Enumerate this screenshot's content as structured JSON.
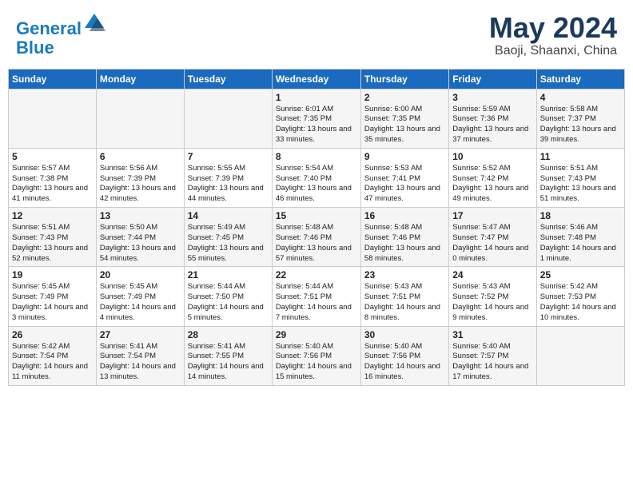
{
  "header": {
    "logo_line1": "General",
    "logo_line2": "Blue",
    "month_title": "May 2024",
    "location": "Baoji, Shaanxi, China"
  },
  "days_of_week": [
    "Sunday",
    "Monday",
    "Tuesday",
    "Wednesday",
    "Thursday",
    "Friday",
    "Saturday"
  ],
  "weeks": [
    [
      {
        "day": "",
        "content": ""
      },
      {
        "day": "",
        "content": ""
      },
      {
        "day": "",
        "content": ""
      },
      {
        "day": "1",
        "content": "Sunrise: 6:01 AM\nSunset: 7:35 PM\nDaylight: 13 hours\nand 33 minutes."
      },
      {
        "day": "2",
        "content": "Sunrise: 6:00 AM\nSunset: 7:35 PM\nDaylight: 13 hours\nand 35 minutes."
      },
      {
        "day": "3",
        "content": "Sunrise: 5:59 AM\nSunset: 7:36 PM\nDaylight: 13 hours\nand 37 minutes."
      },
      {
        "day": "4",
        "content": "Sunrise: 5:58 AM\nSunset: 7:37 PM\nDaylight: 13 hours\nand 39 minutes."
      }
    ],
    [
      {
        "day": "5",
        "content": "Sunrise: 5:57 AM\nSunset: 7:38 PM\nDaylight: 13 hours\nand 41 minutes."
      },
      {
        "day": "6",
        "content": "Sunrise: 5:56 AM\nSunset: 7:39 PM\nDaylight: 13 hours\nand 42 minutes."
      },
      {
        "day": "7",
        "content": "Sunrise: 5:55 AM\nSunset: 7:39 PM\nDaylight: 13 hours\nand 44 minutes."
      },
      {
        "day": "8",
        "content": "Sunrise: 5:54 AM\nSunset: 7:40 PM\nDaylight: 13 hours\nand 46 minutes."
      },
      {
        "day": "9",
        "content": "Sunrise: 5:53 AM\nSunset: 7:41 PM\nDaylight: 13 hours\nand 47 minutes."
      },
      {
        "day": "10",
        "content": "Sunrise: 5:52 AM\nSunset: 7:42 PM\nDaylight: 13 hours\nand 49 minutes."
      },
      {
        "day": "11",
        "content": "Sunrise: 5:51 AM\nSunset: 7:43 PM\nDaylight: 13 hours\nand 51 minutes."
      }
    ],
    [
      {
        "day": "12",
        "content": "Sunrise: 5:51 AM\nSunset: 7:43 PM\nDaylight: 13 hours\nand 52 minutes."
      },
      {
        "day": "13",
        "content": "Sunrise: 5:50 AM\nSunset: 7:44 PM\nDaylight: 13 hours\nand 54 minutes."
      },
      {
        "day": "14",
        "content": "Sunrise: 5:49 AM\nSunset: 7:45 PM\nDaylight: 13 hours\nand 55 minutes."
      },
      {
        "day": "15",
        "content": "Sunrise: 5:48 AM\nSunset: 7:46 PM\nDaylight: 13 hours\nand 57 minutes."
      },
      {
        "day": "16",
        "content": "Sunrise: 5:48 AM\nSunset: 7:46 PM\nDaylight: 13 hours\nand 58 minutes."
      },
      {
        "day": "17",
        "content": "Sunrise: 5:47 AM\nSunset: 7:47 PM\nDaylight: 14 hours\nand 0 minutes."
      },
      {
        "day": "18",
        "content": "Sunrise: 5:46 AM\nSunset: 7:48 PM\nDaylight: 14 hours\nand 1 minute."
      }
    ],
    [
      {
        "day": "19",
        "content": "Sunrise: 5:45 AM\nSunset: 7:49 PM\nDaylight: 14 hours\nand 3 minutes."
      },
      {
        "day": "20",
        "content": "Sunrise: 5:45 AM\nSunset: 7:49 PM\nDaylight: 14 hours\nand 4 minutes."
      },
      {
        "day": "21",
        "content": "Sunrise: 5:44 AM\nSunset: 7:50 PM\nDaylight: 14 hours\nand 5 minutes."
      },
      {
        "day": "22",
        "content": "Sunrise: 5:44 AM\nSunset: 7:51 PM\nDaylight: 14 hours\nand 7 minutes."
      },
      {
        "day": "23",
        "content": "Sunrise: 5:43 AM\nSunset: 7:51 PM\nDaylight: 14 hours\nand 8 minutes."
      },
      {
        "day": "24",
        "content": "Sunrise: 5:43 AM\nSunset: 7:52 PM\nDaylight: 14 hours\nand 9 minutes."
      },
      {
        "day": "25",
        "content": "Sunrise: 5:42 AM\nSunset: 7:53 PM\nDaylight: 14 hours\nand 10 minutes."
      }
    ],
    [
      {
        "day": "26",
        "content": "Sunrise: 5:42 AM\nSunset: 7:54 PM\nDaylight: 14 hours\nand 11 minutes."
      },
      {
        "day": "27",
        "content": "Sunrise: 5:41 AM\nSunset: 7:54 PM\nDaylight: 14 hours\nand 13 minutes."
      },
      {
        "day": "28",
        "content": "Sunrise: 5:41 AM\nSunset: 7:55 PM\nDaylight: 14 hours\nand 14 minutes."
      },
      {
        "day": "29",
        "content": "Sunrise: 5:40 AM\nSunset: 7:56 PM\nDaylight: 14 hours\nand 15 minutes."
      },
      {
        "day": "30",
        "content": "Sunrise: 5:40 AM\nSunset: 7:56 PM\nDaylight: 14 hours\nand 16 minutes."
      },
      {
        "day": "31",
        "content": "Sunrise: 5:40 AM\nSunset: 7:57 PM\nDaylight: 14 hours\nand 17 minutes."
      },
      {
        "day": "",
        "content": ""
      }
    ]
  ]
}
